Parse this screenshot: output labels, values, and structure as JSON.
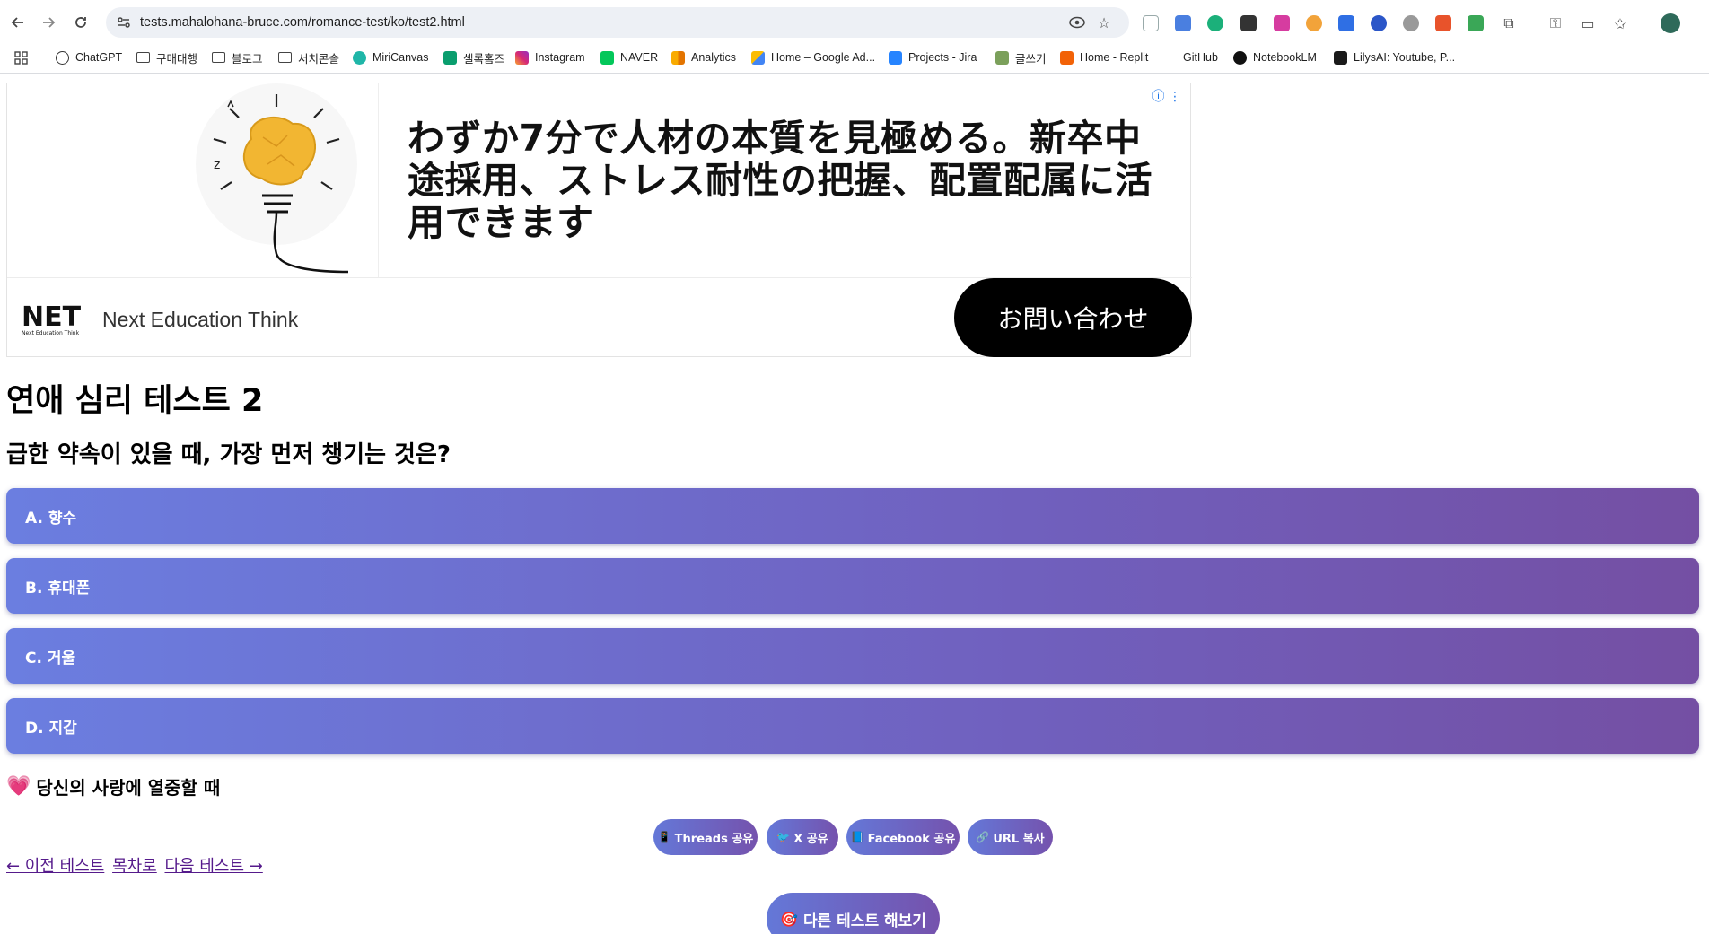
{
  "browser": {
    "url": "tests.mahalohana-bruce.com/romance-test/ko/test2.html",
    "bookmarks": [
      {
        "label": "ChatGPT"
      },
      {
        "label": "구매대행"
      },
      {
        "label": "블로그"
      },
      {
        "label": "서치콘솔"
      },
      {
        "label": "MiriCanvas"
      },
      {
        "label": "셀록홈즈"
      },
      {
        "label": "Instagram"
      },
      {
        "label": "NAVER"
      },
      {
        "label": "Analytics"
      },
      {
        "label": "Home – Google Ad..."
      },
      {
        "label": "Projects - Jira"
      },
      {
        "label": "글쓰기"
      },
      {
        "label": "Home - Replit"
      },
      {
        "label": "GitHub"
      },
      {
        "label": "NotebookLM"
      },
      {
        "label": "LilysAI: Youtube, P..."
      }
    ]
  },
  "ad": {
    "headline": "わずか7分で人材の本質を見極める。新卒中途採用、ストレス耐性の把握、配置配属に活用できます",
    "brand": "Next Education Think",
    "logo_text": "NET",
    "logo_sub": "Next Education Think",
    "cta": "お問い合わせ"
  },
  "test": {
    "title": "연애 심리 테스트 2",
    "question": "급한 약속이 있을 때, 가장 먼저 챙기는 것은?",
    "options": [
      {
        "label": "A. 향수"
      },
      {
        "label": "B. 휴대폰"
      },
      {
        "label": "C. 거울"
      },
      {
        "label": "D. 지갑"
      }
    ],
    "hint": "당신의 사랑에 열중할 때",
    "hint_icon": "heart-icon"
  },
  "share": {
    "threads": "Threads 공유",
    "x": "X 공유",
    "facebook": "Facebook 공유",
    "url": "URL 복사"
  },
  "nav_links": {
    "prev": "← 이전 테스트",
    "toc": "목차로",
    "next": "다음 테스트 →"
  },
  "more_button": "다른 테스트 해보기",
  "colors": {
    "option_gradient_start": "#6b7ee0",
    "option_gradient_end": "#744fa3",
    "ad_cta_bg": "#000000",
    "link": "#551a8b"
  }
}
